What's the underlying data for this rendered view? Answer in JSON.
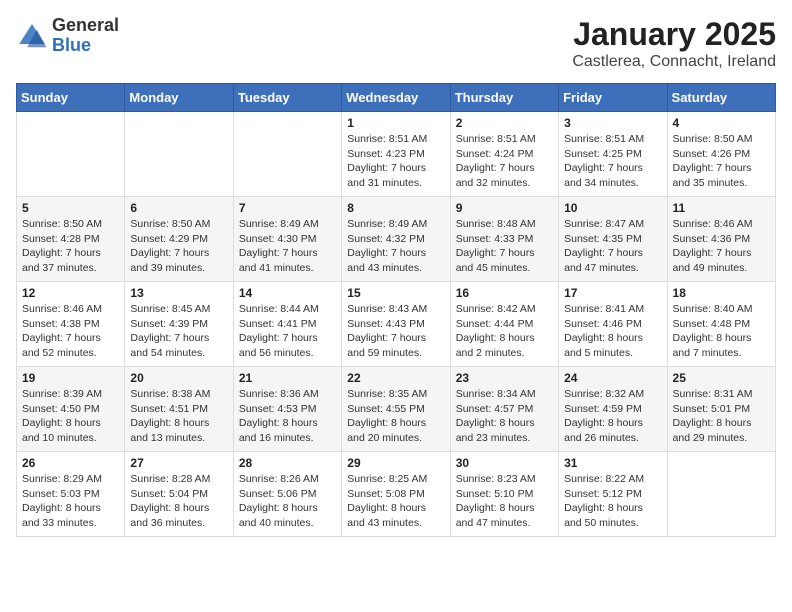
{
  "logo": {
    "line1": "General",
    "line2": "Blue"
  },
  "title": "January 2025",
  "subtitle": "Castlerea, Connacht, Ireland",
  "days_of_week": [
    "Sunday",
    "Monday",
    "Tuesday",
    "Wednesday",
    "Thursday",
    "Friday",
    "Saturday"
  ],
  "weeks": [
    [
      {
        "day": "",
        "info": ""
      },
      {
        "day": "",
        "info": ""
      },
      {
        "day": "",
        "info": ""
      },
      {
        "day": "1",
        "info": "Sunrise: 8:51 AM\nSunset: 4:23 PM\nDaylight: 7 hours\nand 31 minutes."
      },
      {
        "day": "2",
        "info": "Sunrise: 8:51 AM\nSunset: 4:24 PM\nDaylight: 7 hours\nand 32 minutes."
      },
      {
        "day": "3",
        "info": "Sunrise: 8:51 AM\nSunset: 4:25 PM\nDaylight: 7 hours\nand 34 minutes."
      },
      {
        "day": "4",
        "info": "Sunrise: 8:50 AM\nSunset: 4:26 PM\nDaylight: 7 hours\nand 35 minutes."
      }
    ],
    [
      {
        "day": "5",
        "info": "Sunrise: 8:50 AM\nSunset: 4:28 PM\nDaylight: 7 hours\nand 37 minutes."
      },
      {
        "day": "6",
        "info": "Sunrise: 8:50 AM\nSunset: 4:29 PM\nDaylight: 7 hours\nand 39 minutes."
      },
      {
        "day": "7",
        "info": "Sunrise: 8:49 AM\nSunset: 4:30 PM\nDaylight: 7 hours\nand 41 minutes."
      },
      {
        "day": "8",
        "info": "Sunrise: 8:49 AM\nSunset: 4:32 PM\nDaylight: 7 hours\nand 43 minutes."
      },
      {
        "day": "9",
        "info": "Sunrise: 8:48 AM\nSunset: 4:33 PM\nDaylight: 7 hours\nand 45 minutes."
      },
      {
        "day": "10",
        "info": "Sunrise: 8:47 AM\nSunset: 4:35 PM\nDaylight: 7 hours\nand 47 minutes."
      },
      {
        "day": "11",
        "info": "Sunrise: 8:46 AM\nSunset: 4:36 PM\nDaylight: 7 hours\nand 49 minutes."
      }
    ],
    [
      {
        "day": "12",
        "info": "Sunrise: 8:46 AM\nSunset: 4:38 PM\nDaylight: 7 hours\nand 52 minutes."
      },
      {
        "day": "13",
        "info": "Sunrise: 8:45 AM\nSunset: 4:39 PM\nDaylight: 7 hours\nand 54 minutes."
      },
      {
        "day": "14",
        "info": "Sunrise: 8:44 AM\nSunset: 4:41 PM\nDaylight: 7 hours\nand 56 minutes."
      },
      {
        "day": "15",
        "info": "Sunrise: 8:43 AM\nSunset: 4:43 PM\nDaylight: 7 hours\nand 59 minutes."
      },
      {
        "day": "16",
        "info": "Sunrise: 8:42 AM\nSunset: 4:44 PM\nDaylight: 8 hours\nand 2 minutes."
      },
      {
        "day": "17",
        "info": "Sunrise: 8:41 AM\nSunset: 4:46 PM\nDaylight: 8 hours\nand 5 minutes."
      },
      {
        "day": "18",
        "info": "Sunrise: 8:40 AM\nSunset: 4:48 PM\nDaylight: 8 hours\nand 7 minutes."
      }
    ],
    [
      {
        "day": "19",
        "info": "Sunrise: 8:39 AM\nSunset: 4:50 PM\nDaylight: 8 hours\nand 10 minutes."
      },
      {
        "day": "20",
        "info": "Sunrise: 8:38 AM\nSunset: 4:51 PM\nDaylight: 8 hours\nand 13 minutes."
      },
      {
        "day": "21",
        "info": "Sunrise: 8:36 AM\nSunset: 4:53 PM\nDaylight: 8 hours\nand 16 minutes."
      },
      {
        "day": "22",
        "info": "Sunrise: 8:35 AM\nSunset: 4:55 PM\nDaylight: 8 hours\nand 20 minutes."
      },
      {
        "day": "23",
        "info": "Sunrise: 8:34 AM\nSunset: 4:57 PM\nDaylight: 8 hours\nand 23 minutes."
      },
      {
        "day": "24",
        "info": "Sunrise: 8:32 AM\nSunset: 4:59 PM\nDaylight: 8 hours\nand 26 minutes."
      },
      {
        "day": "25",
        "info": "Sunrise: 8:31 AM\nSunset: 5:01 PM\nDaylight: 8 hours\nand 29 minutes."
      }
    ],
    [
      {
        "day": "26",
        "info": "Sunrise: 8:29 AM\nSunset: 5:03 PM\nDaylight: 8 hours\nand 33 minutes."
      },
      {
        "day": "27",
        "info": "Sunrise: 8:28 AM\nSunset: 5:04 PM\nDaylight: 8 hours\nand 36 minutes."
      },
      {
        "day": "28",
        "info": "Sunrise: 8:26 AM\nSunset: 5:06 PM\nDaylight: 8 hours\nand 40 minutes."
      },
      {
        "day": "29",
        "info": "Sunrise: 8:25 AM\nSunset: 5:08 PM\nDaylight: 8 hours\nand 43 minutes."
      },
      {
        "day": "30",
        "info": "Sunrise: 8:23 AM\nSunset: 5:10 PM\nDaylight: 8 hours\nand 47 minutes."
      },
      {
        "day": "31",
        "info": "Sunrise: 8:22 AM\nSunset: 5:12 PM\nDaylight: 8 hours\nand 50 minutes."
      },
      {
        "day": "",
        "info": ""
      }
    ]
  ]
}
